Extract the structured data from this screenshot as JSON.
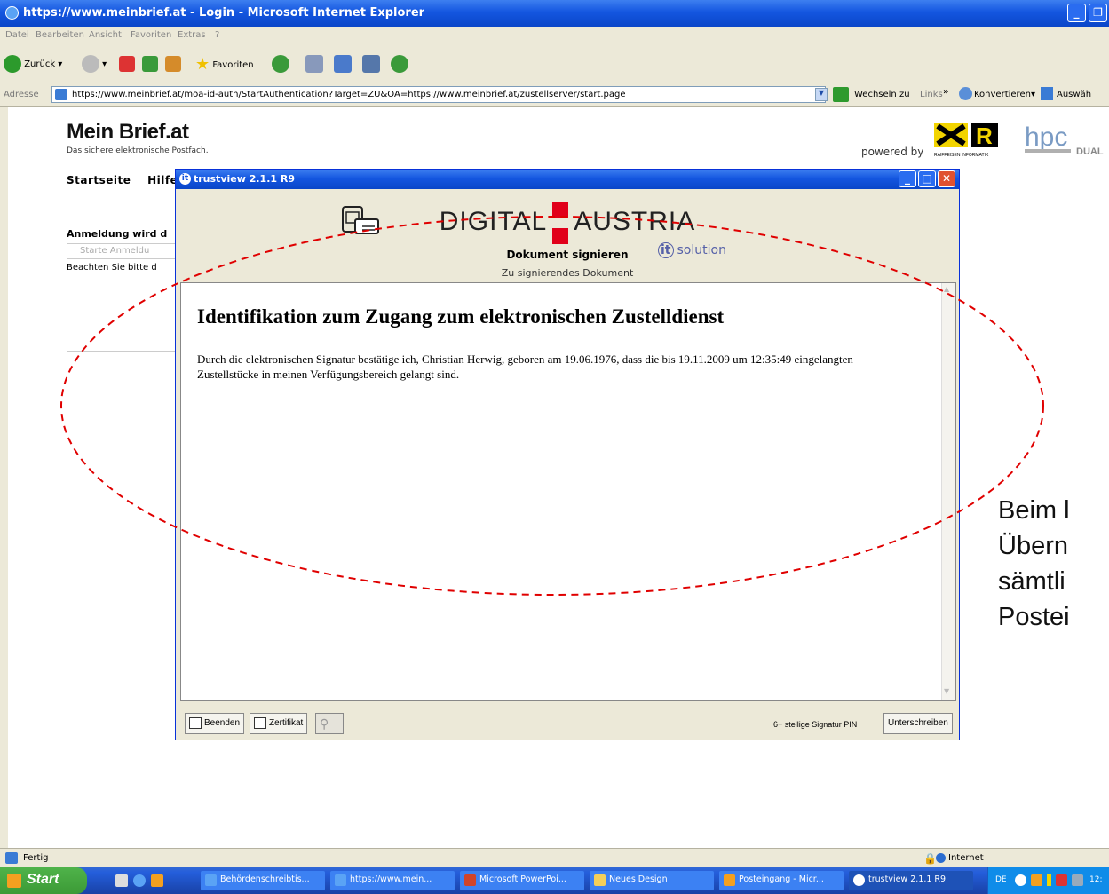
{
  "window": {
    "title": "https://www.meinbrief.at - Login - Microsoft Internet Explorer"
  },
  "menu": [
    "Datei",
    "Bearbeiten",
    "Ansicht",
    "Favoriten",
    "Extras",
    "?"
  ],
  "toolbar": {
    "back_label": "Zurück",
    "favorites_label": "Favoriten"
  },
  "address": {
    "label": "Adresse",
    "url": "https://www.meinbrief.at/moa-id-auth/StartAuthentication?Target=ZU&OA=https://www.meinbrief.at/zustellserver/start.page",
    "go_label": "Wechseln zu",
    "links_label": "Links",
    "konvertieren_label": "Konvertieren",
    "auswaehlen_label": "Auswäh"
  },
  "site": {
    "logo": "Mein Brief.at",
    "tagline": "Das sichere elektronische Postfach.",
    "powered_by": "powered by",
    "sponsor_caption": "RAIFFEISEN INFORMATIK",
    "hpc_logo": "hpc",
    "dual_label": "DUAL",
    "nav": [
      "Startseite",
      "Hilfe"
    ],
    "login_heading": "Anmeldung wird d",
    "start_button": "Starte Anmeldu",
    "note": "Beachten Sie bitte d"
  },
  "dialog": {
    "title": "trustview 2.1.1 R9",
    "brand_left": "DIGITAL",
    "brand_right": "AUSTRIA",
    "subtitle": "Dokument signieren",
    "doc_label": "Zu signierendes Dokument",
    "it_logo": "solution",
    "doc_heading": "Identifikation zum Zugang zum elektronischen Zustelldienst",
    "doc_body": "Durch die elektronischen Signatur bestätige ich, Christian Herwig, geboren am 19.06.1976, dass die bis 19.11.2009 um 12:35:49 eingelangten Zustellstücke in meinen Verfügungsbereich gelangt sind.",
    "btn_beenden": "Beenden",
    "btn_zertifikat": "Zertifikat",
    "pin_label": "6+ stellige Signatur PIN",
    "btn_sign": "Unterschreiben"
  },
  "overlay": {
    "lines": [
      "Beim l",
      "Übern",
      "sämtli",
      "Postei"
    ]
  },
  "status": {
    "text": "Fertig",
    "zone": "Internet"
  },
  "taskbar": {
    "start": "Start",
    "tasks": [
      "Behördenschreibtis...",
      "https://www.mein...",
      "Microsoft PowerPoi...",
      "Neues Design",
      "Posteingang - Micr...",
      "trustview 2.1.1 R9"
    ],
    "tray_lang": "DE",
    "clock": "12:"
  },
  "colors": {
    "xp_blue": "#1456e0",
    "dialog_bg": "#ece9d8",
    "austria_red": "#e1001a",
    "ellipse": "#e00000"
  }
}
